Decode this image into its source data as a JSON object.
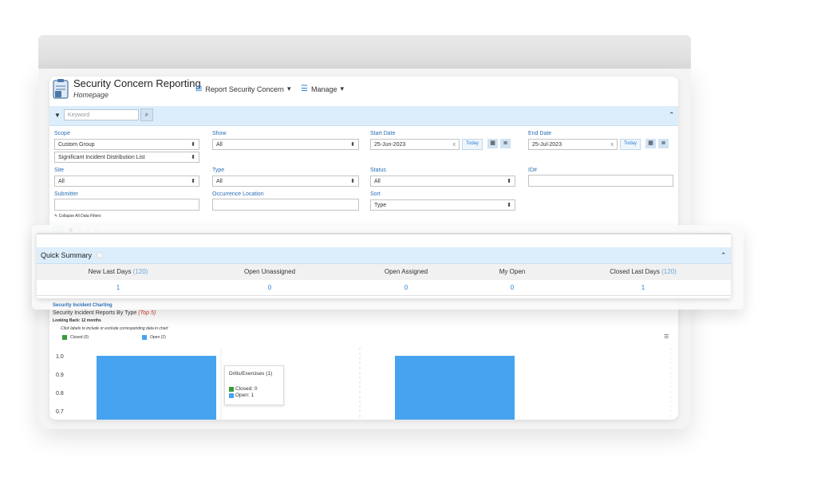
{
  "app": {
    "title": "Security Concern Reporting",
    "subtitle": "Homepage"
  },
  "menu": {
    "report_label": "Report Security Concern",
    "manage_label": "Manage"
  },
  "filters": {
    "keyword_placeholder": "Keyword",
    "scope_label": "Scope",
    "scope_value": "Custom Group",
    "scope_value2": "Significant Incident Distribution List",
    "show_label": "Show",
    "show_value": "All",
    "start_label": "Start Date",
    "start_value": "25-Jun-2023",
    "end_label": "End Date",
    "end_value": "25-Jul-2023",
    "today_label": "Today",
    "clear_x": "x",
    "site_label": "Site",
    "site_value": "All",
    "type_label": "Type",
    "type_value": "All",
    "status_label": "Status",
    "status_value": "All",
    "id_label": "ID#",
    "id_value": "",
    "submitter_label": "Submitter",
    "submitter_value": "",
    "occurrence_label": "Occurrence Location",
    "occurrence_value": "",
    "sort_label": "Sort",
    "sort_value": "Type",
    "collapse_label": "Collapse All Data Filters"
  },
  "quick_summary": {
    "title": "Quick Summary",
    "columns": [
      {
        "label": "New Last Days",
        "count": "(120)",
        "value": "1"
      },
      {
        "label": "Open Unassigned",
        "count": "",
        "value": "0"
      },
      {
        "label": "Open Assigned",
        "count": "",
        "value": "0"
      },
      {
        "label": "My Open",
        "count": "",
        "value": "0"
      },
      {
        "label": "Closed Last Days",
        "count": "(120)",
        "value": "1"
      }
    ]
  },
  "charting": {
    "section_title": "Security Incident Charting",
    "chart_title": "Security Incident Reports By Type",
    "chart_title_note": "(Top 5)",
    "looking_back": "Looking Back: 12 months",
    "hint": "Click labels to include or exclude corresponding data in chart",
    "tooltip_title": "Drills/Exercises (1)",
    "tooltip_closed": "Closed: 0",
    "tooltip_open": "Open: 1"
  },
  "chart_data": {
    "type": "bar",
    "categories": [
      "",
      "Drills/Exercises"
    ],
    "series": [
      {
        "name": "Closed (0)",
        "color": "#3a9a3a",
        "values": [
          0,
          0
        ]
      },
      {
        "name": "Open (2)",
        "color": "#45a3f0",
        "values": [
          1,
          1
        ]
      }
    ],
    "yticks": [
      "1.0",
      "0.9",
      "0.8",
      "0.7"
    ],
    "ylim": [
      0.65,
      1.0
    ],
    "legend": "top-left"
  },
  "colors": {
    "accent": "#2a7fd0",
    "header_bg": "#dceefb",
    "bar": "#45a3f0",
    "closed": "#3a9a3a"
  }
}
